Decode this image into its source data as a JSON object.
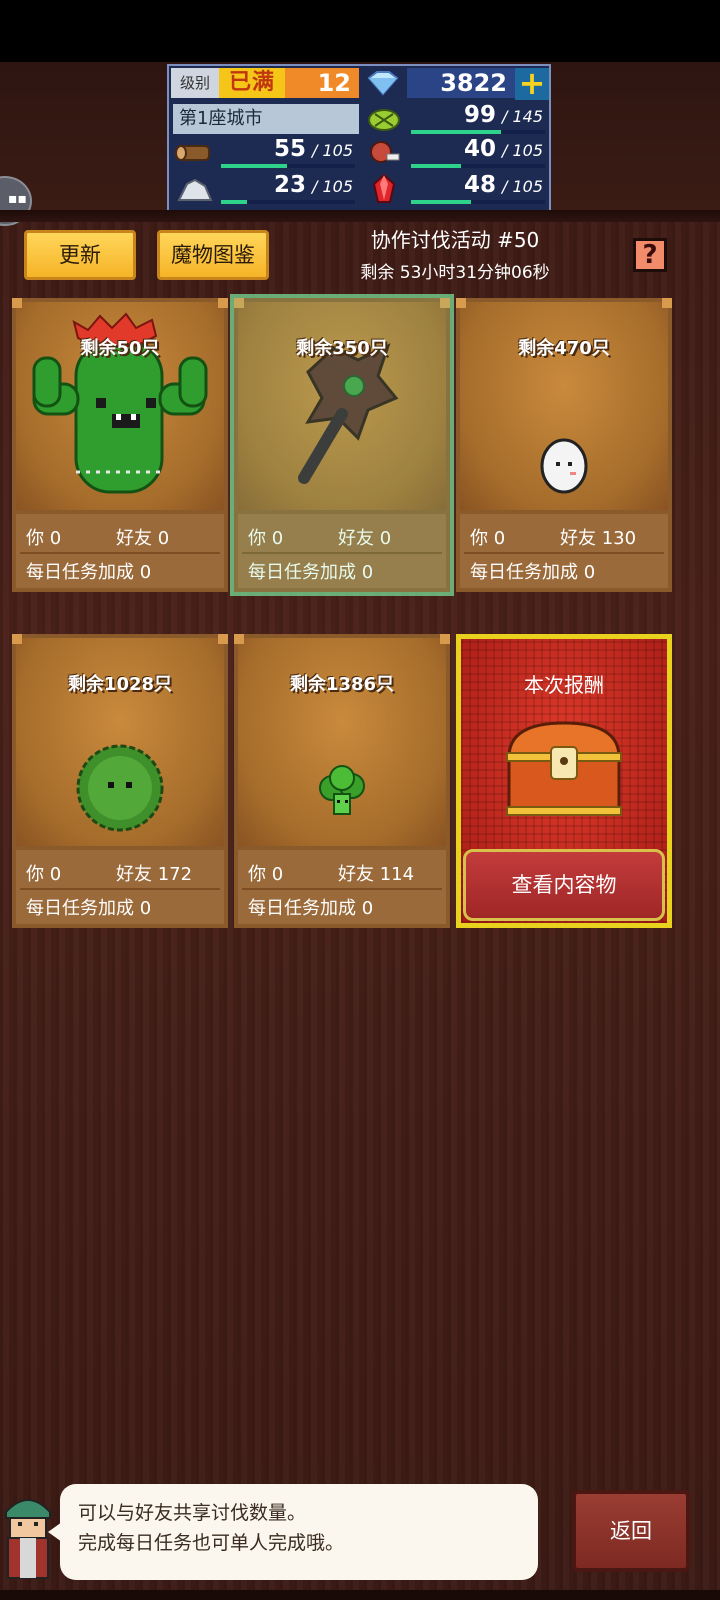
{
  "status": {
    "level_label": "级别",
    "level_max": "已满",
    "level": "12",
    "gems": "3822",
    "city": "第1座城市",
    "resources": [
      {
        "icon": "wood-icon",
        "cur": "55",
        "max": "105",
        "fill": 0.52
      },
      {
        "icon": "stone-icon",
        "cur": "23",
        "max": "105",
        "fill": 0.22
      },
      {
        "icon": "food-icon",
        "cur": "99",
        "max": "145",
        "fill": 0.68
      },
      {
        "icon": "meat-icon",
        "cur": "40",
        "max": "105",
        "fill": 0.38
      },
      {
        "icon": "ruby-icon",
        "cur": "48",
        "max": "105",
        "fill": 0.46
      }
    ]
  },
  "toolbar": {
    "refresh": "更新",
    "bestiary": "魔物图鉴",
    "help": "?"
  },
  "event": {
    "title": "协作讨伐活动 #50",
    "timer": "剩余 53小时31分钟06秒"
  },
  "labels": {
    "you": "你",
    "friend": "好友",
    "daily": "每日任务加成"
  },
  "monsters": [
    {
      "remain": "剩余50只",
      "you": "0",
      "friend": "0",
      "daily": "0",
      "icon": "cactus-monster"
    },
    {
      "remain": "剩余350只",
      "you": "0",
      "friend": "0",
      "daily": "0",
      "icon": "thorn-staff-monster"
    },
    {
      "remain": "剩余470只",
      "you": "0",
      "friend": "130",
      "daily": "0",
      "icon": "egg-monster"
    },
    {
      "remain": "剩余1028只",
      "you": "0",
      "friend": "172",
      "daily": "0",
      "icon": "moss-ball-monster"
    },
    {
      "remain": "剩余1386只",
      "you": "0",
      "friend": "114",
      "daily": "0",
      "icon": "broccoli-monster"
    }
  ],
  "reward": {
    "title": "本次报酬",
    "button": "查看内容物"
  },
  "hint": {
    "line1": "可以与好友共享讨伐数量。",
    "line2": "完成每日任务也可单人完成哦。"
  },
  "back": "返回",
  "colors": {
    "accent_yellow": "#f6b428",
    "bar_green": "#2ed38b",
    "panel_blue": "#1d2a52",
    "reward_red": "#c33c3c"
  }
}
